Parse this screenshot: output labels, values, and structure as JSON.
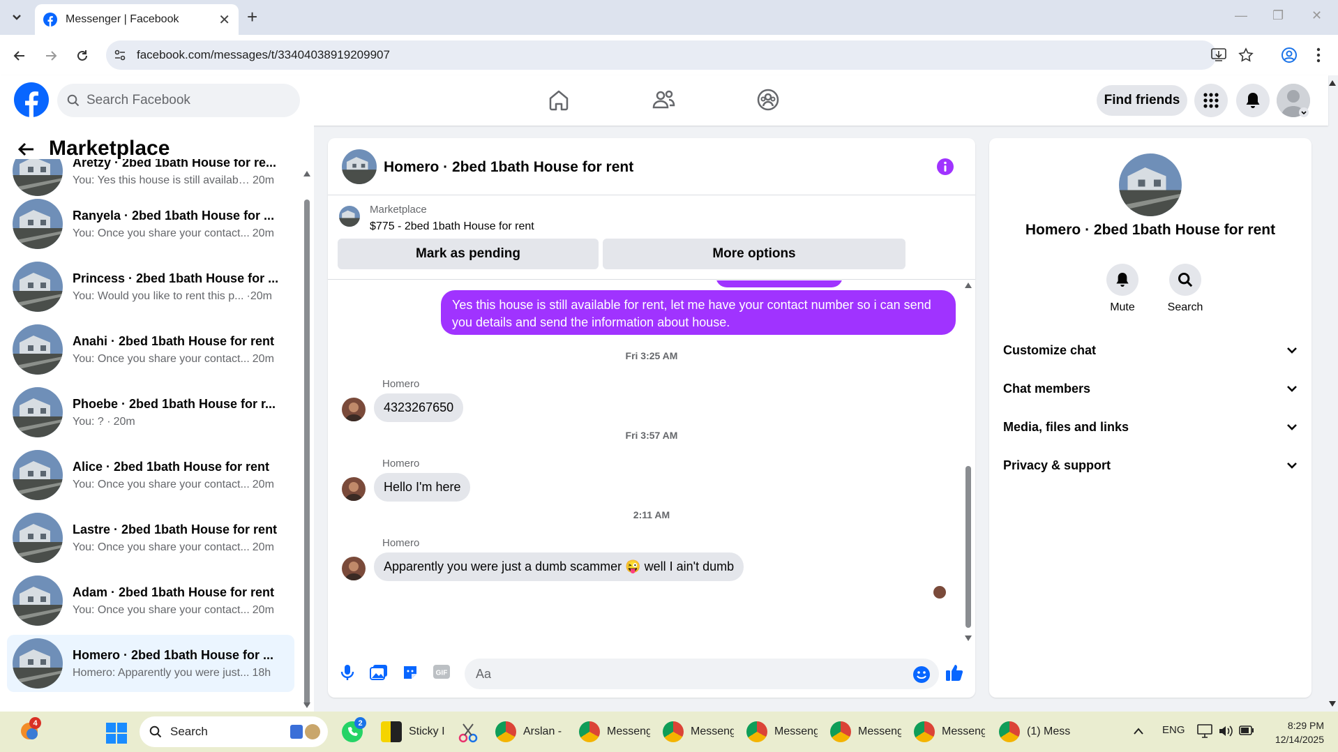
{
  "browser": {
    "tab_title": "Messenger | Facebook",
    "url": "facebook.com/messages/t/33404038919209907"
  },
  "fb_header": {
    "search_placeholder": "Search Facebook",
    "find_friends": "Find friends"
  },
  "sidebar": {
    "title": "Marketplace",
    "conversations": [
      {
        "name": "Aretzy · 2bed 1bath House for re...",
        "snippet": "You: Yes this house is still availabl...",
        "time": "20m"
      },
      {
        "name": "Ranyela · 2bed 1bath House for ...",
        "snippet": "You: Once you share your contact...",
        "time": "20m"
      },
      {
        "name": "Princess · 2bed 1bath House for ...",
        "snippet": "You: Would you like to rent this p...",
        "time": "·20m"
      },
      {
        "name": "Anahi · 2bed 1bath House for rent",
        "snippet": "You: Once you share your contact...",
        "time": "20m"
      },
      {
        "name": "Phoebe · 2bed 1bath House for r...",
        "snippet": "You: ? ·",
        "time": "20m"
      },
      {
        "name": "Alice · 2bed 1bath House for rent",
        "snippet": "You: Once you share your contact...",
        "time": "20m"
      },
      {
        "name": "Lastre · 2bed 1bath House for rent",
        "snippet": "You: Once you share your contact...",
        "time": "20m"
      },
      {
        "name": "Adam · 2bed 1bath House for rent",
        "snippet": "You: Once you share your contact...",
        "time": "20m"
      },
      {
        "name": "Homero · 2bed 1bath House for ...",
        "snippet": "Homero: Apparently you were just...",
        "time": "18h"
      }
    ]
  },
  "chat": {
    "title": "Homero · 2bed 1bath House for rent",
    "marketplace_label": "Marketplace",
    "listing": "$775 - 2bed 1bath House for rent",
    "mark_pending": "Mark as pending",
    "more_options": "More options",
    "outgoing_message": "Yes this house is still available for rent, let me have your contact number so i can send you details and send the information about house.",
    "ts1": "Fri 3:25 AM",
    "ts2": "Fri 3:57 AM",
    "ts3": "2:11 AM",
    "sender": "Homero",
    "msg1": "4323267650",
    "msg2": "Hello I'm here",
    "msg3a": "Apparently you were just a dumb scammer",
    "msg3_emoji": "😜",
    "msg3b": "well I ain't dumb",
    "composer_placeholder": "Aa"
  },
  "info_panel": {
    "title": "Homero · 2bed 1bath House for rent",
    "mute": "Mute",
    "search": "Search",
    "items": [
      "Customize chat",
      "Chat members",
      "Media, files and links",
      "Privacy & support"
    ]
  },
  "taskbar": {
    "search": "Search",
    "weather_badge": "4",
    "whatsapp_badge": "2",
    "items": [
      "Sticky I",
      "Arslan -",
      "Messeng",
      "Messeng",
      "Messeng",
      "Messeng",
      "Messeng",
      "(1) Mess"
    ],
    "lang": "ENG",
    "time": "8:29 PM",
    "date": "12/14/2025"
  },
  "colors": {
    "accent": "#a033ff",
    "fb_blue": "#0866ff"
  }
}
